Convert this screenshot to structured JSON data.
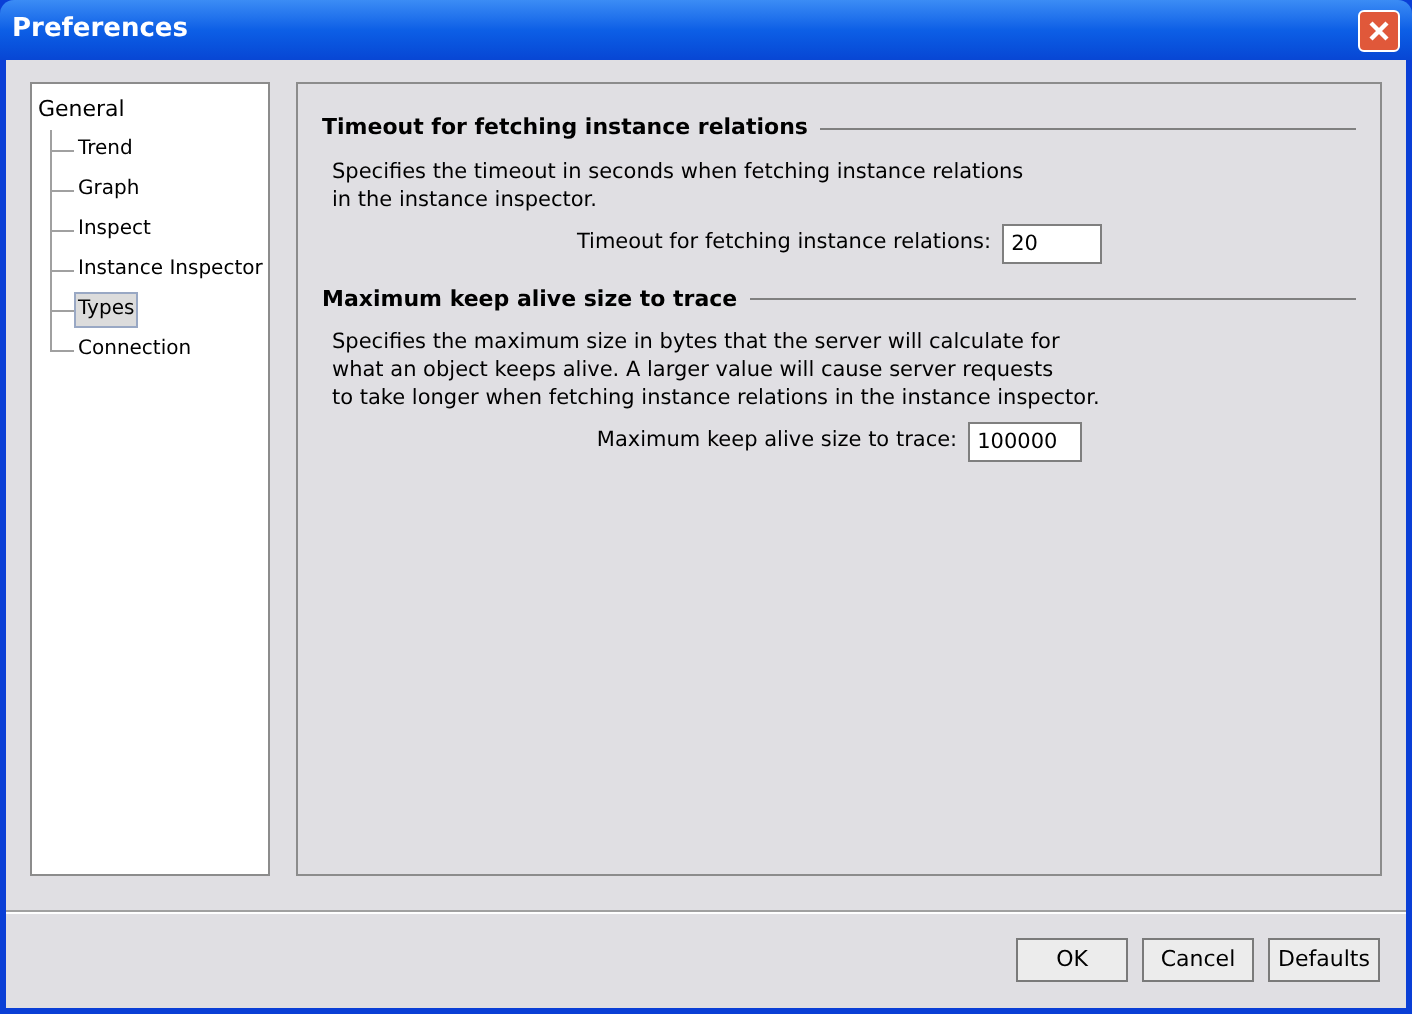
{
  "window": {
    "title": "Preferences"
  },
  "tree": {
    "label": "General",
    "children": [
      {
        "label": "Trend",
        "selected": false
      },
      {
        "label": "Graph",
        "selected": false
      },
      {
        "label": "Inspect",
        "selected": false
      },
      {
        "label": "Instance Inspector",
        "selected": false
      },
      {
        "label": "Types",
        "selected": true
      },
      {
        "label": "Connection",
        "selected": false
      }
    ]
  },
  "sections": [
    {
      "title": "Timeout for fetching instance relations",
      "description": "Specifies the timeout in seconds when fetching instance relations\nin the instance inspector.",
      "field_label": "Timeout for fetching instance relations:",
      "value": "20"
    },
    {
      "title": "Maximum keep alive size to trace",
      "description": "Specifies the maximum size in bytes that the server will calculate for\nwhat an object keeps alive. A larger value will cause server requests\nto take longer when fetching instance relations in the instance inspector.",
      "field_label": "Maximum keep alive size to trace:",
      "value": "100000"
    }
  ],
  "buttons": [
    "OK",
    "Cancel",
    "Defaults"
  ]
}
